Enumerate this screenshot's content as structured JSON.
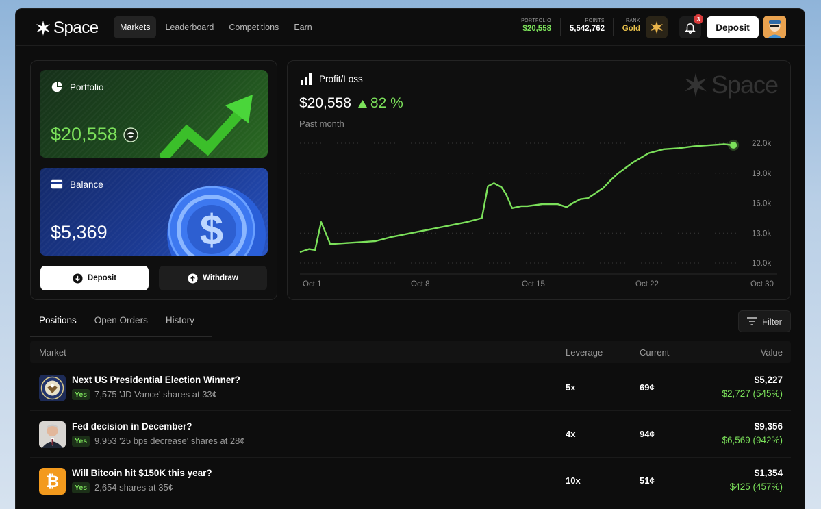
{
  "header": {
    "logo_text": "Space",
    "nav": [
      {
        "label": "Markets",
        "active": true
      },
      {
        "label": "Leaderboard",
        "active": false
      },
      {
        "label": "Competitions",
        "active": false
      },
      {
        "label": "Earn",
        "active": false
      }
    ],
    "portfolio_label": "PORTFOLIO",
    "portfolio_value": "$20,558",
    "points_label": "POINTS",
    "points_value": "5,542,762",
    "rank_label": "RANK",
    "rank_value": "Gold",
    "notification_count": "3",
    "deposit_label": "Deposit"
  },
  "portfolio_card": {
    "title": "Portfolio",
    "value": "$20,558",
    "icon": "pie-chart-icon"
  },
  "balance_card": {
    "title": "Balance",
    "value": "$5,369",
    "icon": "wallet-icon"
  },
  "actions": {
    "deposit_label": "Deposit",
    "withdraw_label": "Withdraw"
  },
  "pnl": {
    "title": "Profit/Loss",
    "value": "$20,558",
    "change": "82 %",
    "period": "Past month",
    "watermark": "Space"
  },
  "chart_data": {
    "type": "line",
    "title": "",
    "xlabel": "",
    "ylabel": "",
    "x_ticks": [
      "Oct 1",
      "Oct 8",
      "Oct 15",
      "Oct 22",
      "Oct 30"
    ],
    "y_ticks": [
      "22.0k",
      "19.0k",
      "16.0k",
      "13.0k",
      "10.0k"
    ],
    "ylim": [
      10000,
      22000
    ],
    "grid": true,
    "series": [
      {
        "color": "#7be05a",
        "x": [
          1,
          1.6,
          2,
          2.4,
          3,
          4,
          5,
          6,
          7,
          8,
          9,
          10,
          11,
          12,
          13,
          13.4,
          13.8,
          14.3,
          14.6,
          15,
          15.6,
          16,
          17,
          18,
          18.6,
          19,
          19.5,
          20,
          20.5,
          21,
          21.5,
          22,
          23,
          24,
          25,
          26,
          27,
          28,
          29,
          29.6
        ],
        "y": [
          11100,
          11400,
          11300,
          14100,
          11900,
          12000,
          12100,
          12200,
          12600,
          12900,
          13200,
          13500,
          13800,
          14100,
          14500,
          17700,
          18000,
          17600,
          16900,
          15500,
          15700,
          15700,
          15900,
          15900,
          15600,
          16000,
          16400,
          16500,
          17000,
          17500,
          18300,
          19000,
          20100,
          21000,
          21400,
          21500,
          21700,
          21800,
          21900,
          21800
        ]
      }
    ],
    "end_marker_color": "#7be05a"
  },
  "tabs": [
    {
      "label": "Positions",
      "active": true
    },
    {
      "label": "Open Orders",
      "active": false
    },
    {
      "label": "History",
      "active": false
    }
  ],
  "filter_label": "Filter",
  "table": {
    "columns": {
      "market": "Market",
      "leverage": "Leverage",
      "current": "Current",
      "value": "Value"
    },
    "rows": [
      {
        "icon": "presidential-seal-icon",
        "question": "Next US Presidential Election Winner?",
        "outcome": "Yes",
        "description": "7,575 'JD Vance' shares at 33¢",
        "leverage": "5x",
        "current": "69¢",
        "value": "$5,227",
        "gain": "$2,727 (545%)"
      },
      {
        "icon": "fed-chair-portrait-icon",
        "question": "Fed decision in December?",
        "outcome": "Yes",
        "description": "9,953 '25 bps decrease' shares at 28¢",
        "leverage": "4x",
        "current": "94¢",
        "value": "$9,356",
        "gain": "$6,569 (942%)"
      },
      {
        "icon": "bitcoin-icon",
        "question": "Will Bitcoin hit $150K this year?",
        "outcome": "Yes",
        "description": "2,654 shares at 35¢",
        "leverage": "10x",
        "current": "51¢",
        "value": "$1,354",
        "gain": "$425 (457%)"
      }
    ]
  }
}
